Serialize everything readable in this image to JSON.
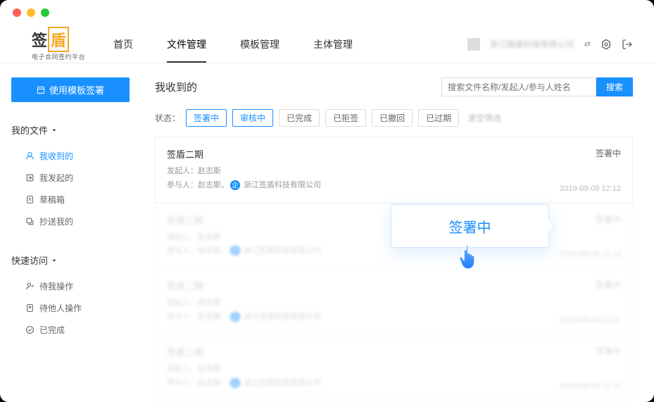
{
  "logo": {
    "main1": "签",
    "main2": "盾",
    "sub": "电子合同签约平台"
  },
  "nav": [
    "首页",
    "文件管理",
    "模板管理",
    "主体管理"
  ],
  "nav_active": 1,
  "header_right": {
    "org_name": "浙江融盾科技有限公司"
  },
  "sidebar": {
    "primary_btn": "使用模板签署",
    "sections": [
      {
        "title": "我的文件",
        "items": [
          "我收到的",
          "我发起的",
          "草稿箱",
          "抄送我的"
        ],
        "active": 0
      },
      {
        "title": "快速访问",
        "items": [
          "待我操作",
          "待他人操作",
          "已完成"
        ]
      }
    ]
  },
  "main": {
    "title": "我收到的",
    "search_placeholder": "搜索文件名称/发起人/参与人姓名",
    "search_btn": "搜索",
    "filter_label": "状态：",
    "filters": [
      "签署中",
      "审核中",
      "已完成",
      "已拒签",
      "已撤回",
      "已过期"
    ],
    "filter_clear": "清空筛选",
    "filter_active": [
      0,
      1
    ]
  },
  "tooltip": "签署中",
  "docs": [
    {
      "title": "签盾二期",
      "initiator_label": "发起人：",
      "initiator": "赵志斯",
      "participant_label": "参与人：",
      "participant": "赵志斯、",
      "company": "浙江签盾科技有限公司",
      "status": "签署中",
      "time": "2019-09-09  12:12"
    },
    {
      "title": "签盾二期",
      "initiator_label": "发起人：",
      "initiator": "赵志斯",
      "participant_label": "参与人：",
      "participant": "赵志斯、",
      "company": "浙江签盾科技有限公司",
      "status": "签署中",
      "time": "2019-09-09  12:12"
    },
    {
      "title": "签盾二期",
      "initiator_label": "发起人：",
      "initiator": "赵志斯",
      "participant_label": "参与人：",
      "participant": "赵志斯、",
      "company": "浙江签盾科技有限公司",
      "status": "签署中",
      "time": "2019-09-09  12:12"
    },
    {
      "title": "签盾二期",
      "initiator_label": "发起人：",
      "initiator": "赵志斯",
      "participant_label": "参与人：",
      "participant": "赵志斯、",
      "company": "浙江签盾科技有限公司",
      "status": "签署中",
      "time": "2019-09-09  12:12"
    }
  ]
}
